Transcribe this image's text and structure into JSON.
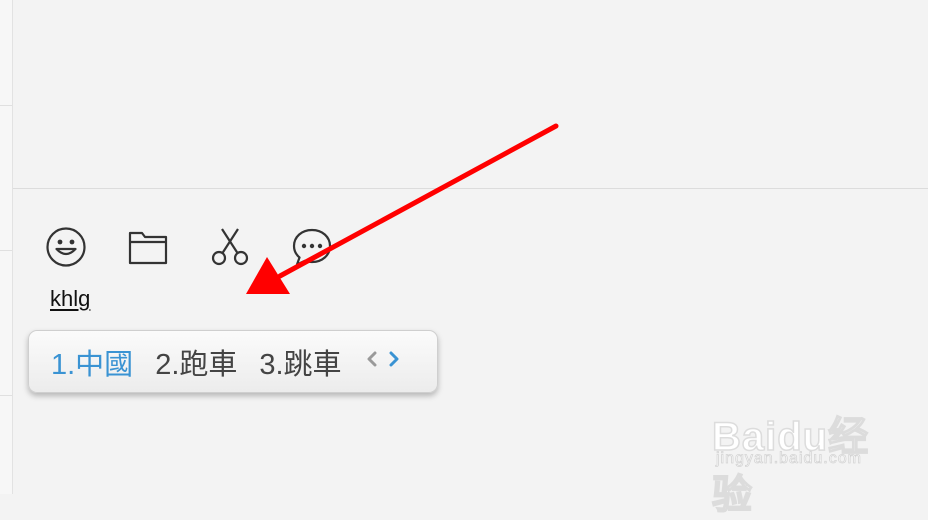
{
  "toolbar": {
    "items": [
      {
        "name": "emoji-button",
        "icon": "smiley-icon"
      },
      {
        "name": "folder-button",
        "icon": "folder-icon"
      },
      {
        "name": "screenshot-button",
        "icon": "scissors-icon"
      },
      {
        "name": "chat-record-button",
        "icon": "speech-bubble-icon"
      }
    ]
  },
  "composition": {
    "text": "khlg"
  },
  "ime": {
    "candidates": [
      {
        "label": "1.中國",
        "selected": true
      },
      {
        "label": "2.跑車",
        "selected": false
      },
      {
        "label": "3.跳車",
        "selected": false
      }
    ],
    "prev_icon": "chevron-left-icon",
    "next_icon": "chevron-right-icon"
  },
  "annotation": {
    "arrow_color": "#ff0000"
  },
  "watermark": {
    "logo": "Baidu经验",
    "sub": "jingyan.baidu.com"
  },
  "colors": {
    "selected_candidate": "#3a93d3",
    "candidate": "#444444",
    "background": "#f3f3f3"
  }
}
